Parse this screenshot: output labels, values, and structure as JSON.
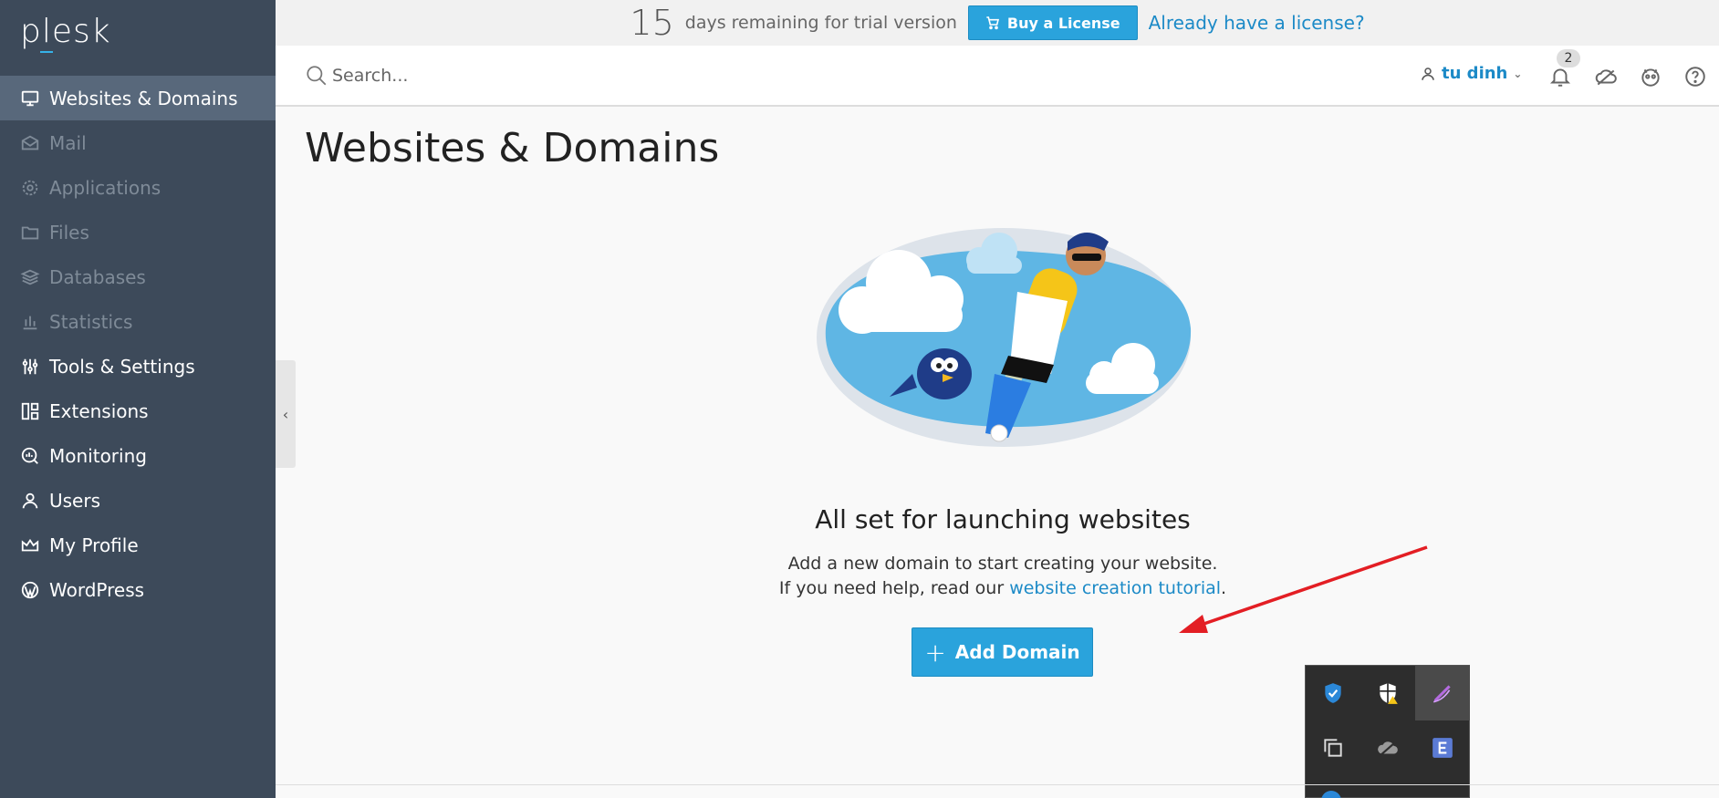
{
  "sidebar": {
    "logo": "plesk",
    "items": [
      {
        "label": "Websites & Domains",
        "icon": "monitor-icon",
        "active": true,
        "muted": false
      },
      {
        "label": "Mail",
        "icon": "mail-icon",
        "active": false,
        "muted": true
      },
      {
        "label": "Applications",
        "icon": "gear-icon",
        "active": false,
        "muted": true
      },
      {
        "label": "Files",
        "icon": "folder-icon",
        "active": false,
        "muted": true
      },
      {
        "label": "Databases",
        "icon": "layers-icon",
        "active": false,
        "muted": true
      },
      {
        "label": "Statistics",
        "icon": "bar-chart-icon",
        "active": false,
        "muted": true
      },
      {
        "label": "Tools & Settings",
        "icon": "sliders-icon",
        "active": false,
        "muted": false
      },
      {
        "label": "Extensions",
        "icon": "extensions-icon",
        "active": false,
        "muted": false
      },
      {
        "label": "Monitoring",
        "icon": "monitoring-icon",
        "active": false,
        "muted": false
      },
      {
        "label": "Users",
        "icon": "user-icon",
        "active": false,
        "muted": false
      },
      {
        "label": "My Profile",
        "icon": "crown-icon",
        "active": false,
        "muted": false
      },
      {
        "label": "WordPress",
        "icon": "wordpress-icon",
        "active": false,
        "muted": false
      }
    ]
  },
  "trial": {
    "days": "15",
    "text": "days remaining for trial version",
    "buy_label": "Buy a License",
    "license_link": "Already have a license?"
  },
  "header": {
    "search_placeholder": "Search...",
    "user_name": "tu dinh",
    "notification_count": "2"
  },
  "main": {
    "title": "Websites & Domains",
    "heading": "All set for launching websites",
    "desc_line1": "Add a new domain to start creating your website.",
    "desc_line2_prefix": "If you need help, read our",
    "desc_link": "website creation tutorial",
    "desc_line2_suffix": ".",
    "add_button": "Add Domain"
  },
  "colors": {
    "sidebar_bg": "#3d4a5a",
    "sidebar_active": "#58687b",
    "accent": "#2aa3dc",
    "link": "#1c8ac7"
  },
  "tray": {
    "icons": [
      "defender-icon",
      "security-warning-icon",
      "pen-icon",
      "copy-icon",
      "cloud-off-icon",
      "app-e-icon"
    ]
  }
}
